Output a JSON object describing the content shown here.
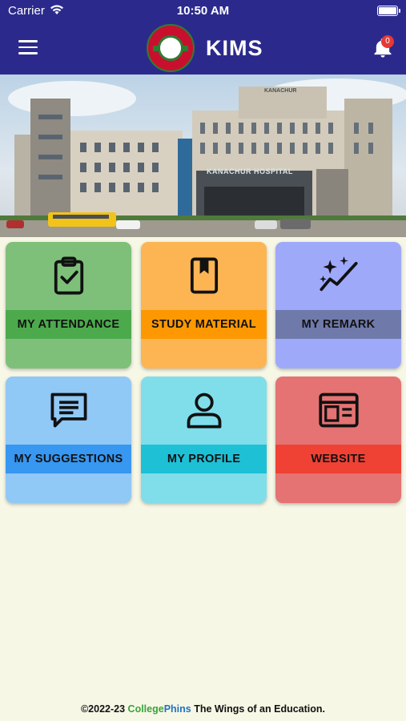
{
  "status_bar": {
    "carrier": "Carrier",
    "time": "10:50 AM"
  },
  "header": {
    "title": "KIMS",
    "notification_count": "0"
  },
  "banner": {
    "hospital_sign": "KANACHUR HOSPITAL",
    "institute_sign": "KANACHUR"
  },
  "tiles": [
    {
      "label": "MY ATTENDANCE",
      "icon": "clipboard-check-icon",
      "bg": "#7ec07a",
      "band": "#4caa4c"
    },
    {
      "label": "STUDY MATERIAL",
      "icon": "book-bookmark-icon",
      "bg": "#fdb553",
      "band": "#fd9803"
    },
    {
      "label": "MY REMARK",
      "icon": "sparkle-trend-icon",
      "bg": "#9fa9fa",
      "band": "#6f7aab"
    },
    {
      "label": "MY SUGGESTIONS",
      "icon": "chat-lines-icon",
      "bg": "#90c8f6",
      "band": "#3797f1"
    },
    {
      "label": "MY PROFILE",
      "icon": "person-icon",
      "bg": "#80deea",
      "band": "#1ec0d6"
    },
    {
      "label": "WEBSITE",
      "icon": "browser-window-icon",
      "bg": "#e57373",
      "band": "#f04135"
    }
  ],
  "footer": {
    "copyright": "©2022-23",
    "brand_part1": "College",
    "brand_part2": "Phins",
    "tagline": "The Wings of an Education."
  }
}
